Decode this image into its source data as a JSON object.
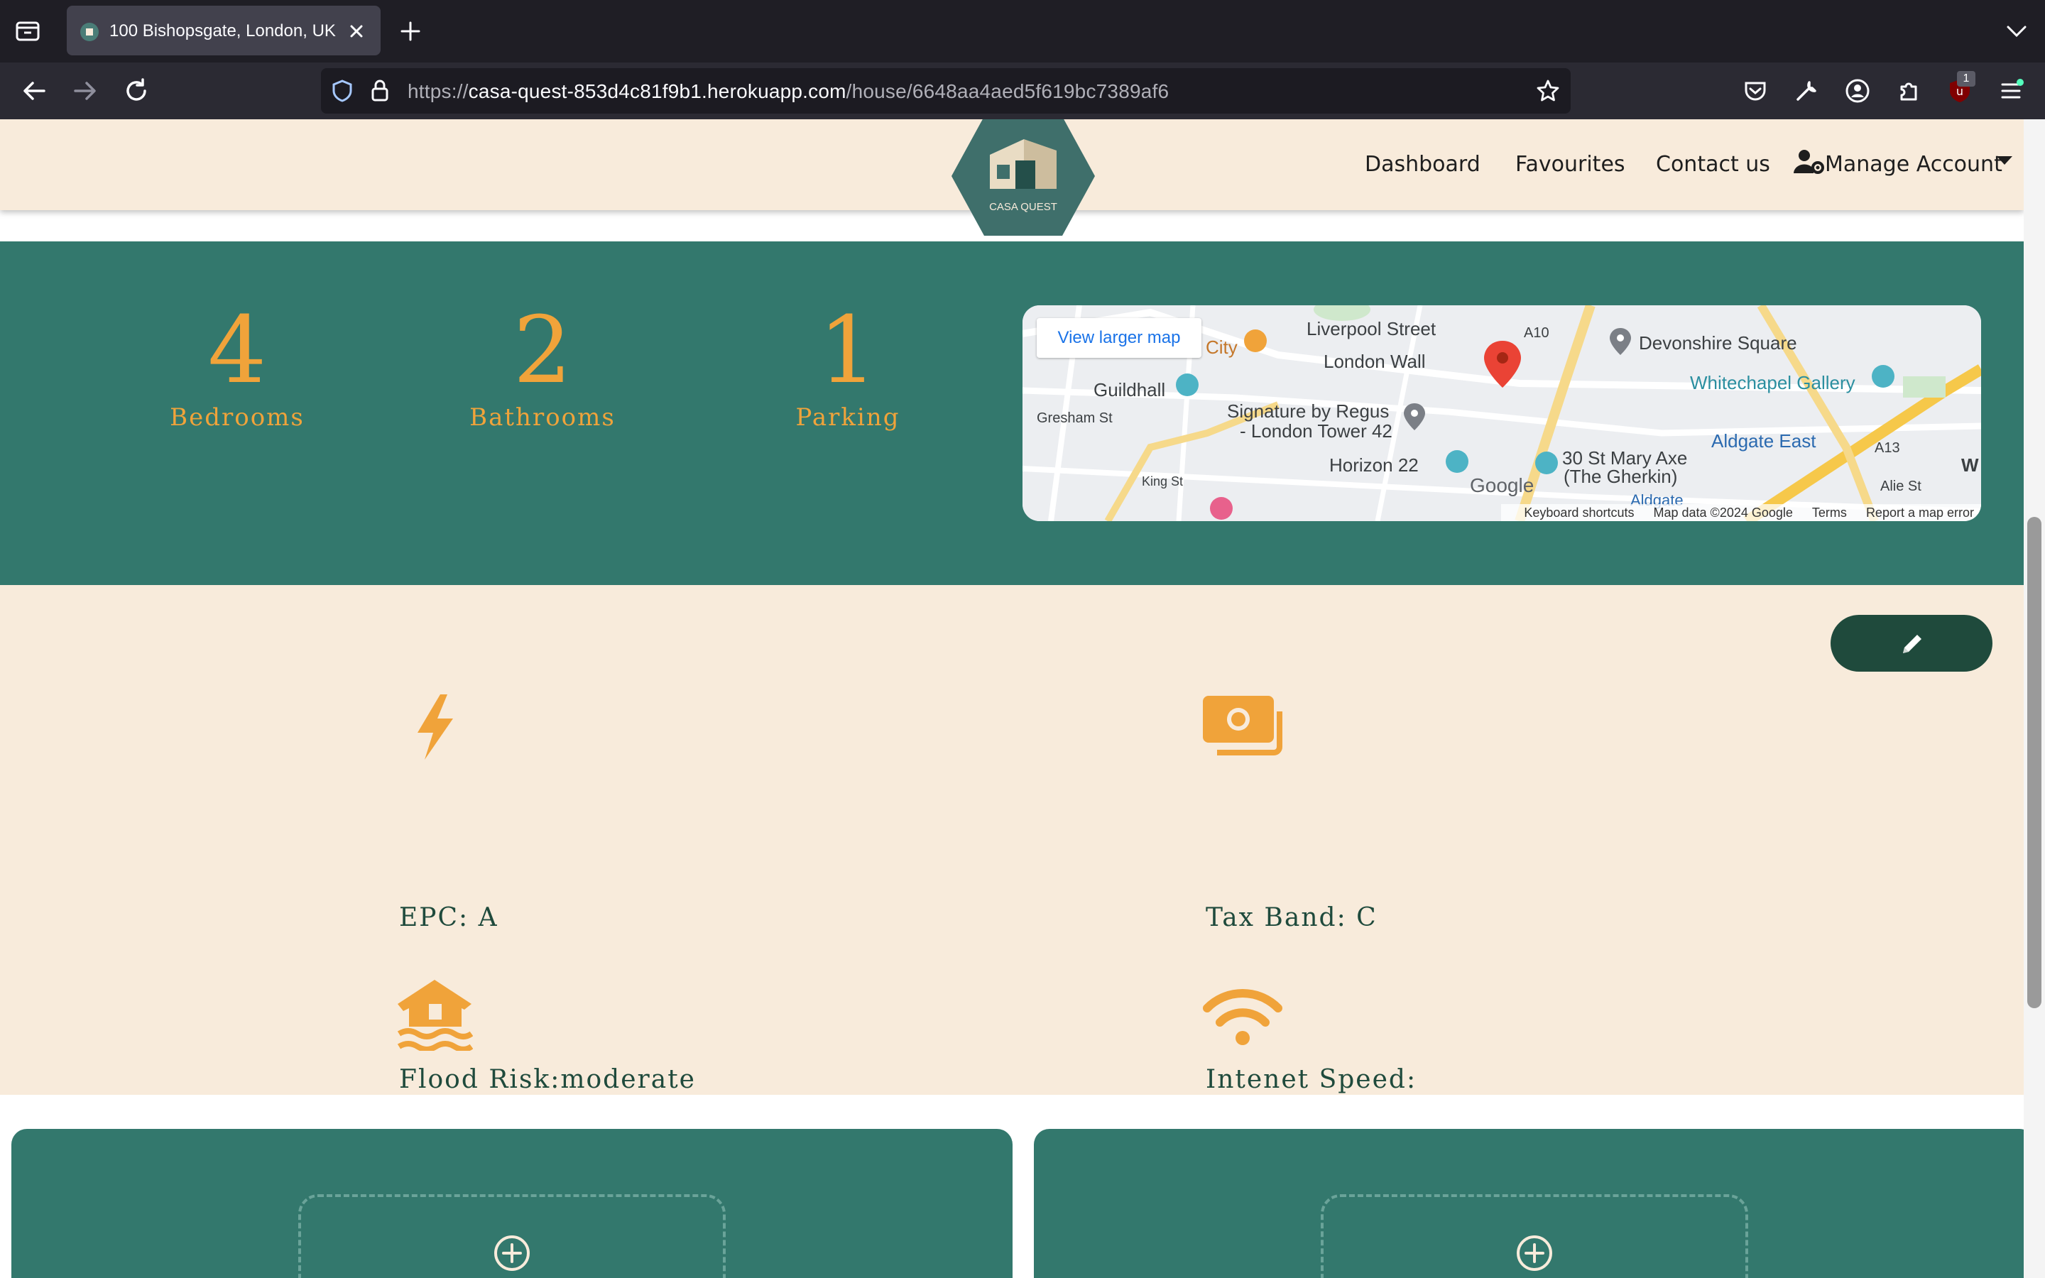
{
  "browser": {
    "tab_title": "100 Bishopsgate, London, UK",
    "url_scheme": "https://",
    "url_host": "casa-quest-853d4c81f9b1.herokuapp.com",
    "url_path": "/house/6648aa4aed5f619bc7389af6",
    "extension_badge": "1"
  },
  "header": {
    "logo_text": "CASA QUEST",
    "nav": [
      "Dashboard",
      "Favourites",
      "Contact us",
      "Manage Account"
    ]
  },
  "stats": [
    {
      "value": "4",
      "label": "Bedrooms"
    },
    {
      "value": "2",
      "label": "Bathrooms"
    },
    {
      "value": "1",
      "label": "Parking"
    }
  ],
  "map": {
    "view_larger": "View larger map",
    "labels": {
      "liverpool": "Liverpool Street",
      "devonshire": "Devonshire Square",
      "city": "City",
      "london_wall": "London Wall",
      "guildhall": "Guildhall",
      "whitechapel": "Whitechapel Gallery",
      "signature1": "Signature by Regus",
      "signature2": "- London Tower 42",
      "gresham": "Gresham St",
      "aldgate_east": "Aldgate East",
      "a10": "A10",
      "a13": "A13",
      "horizon": "Horizon 22",
      "mary_axe1": "30 St Mary Axe",
      "mary_axe2": "(The Gherkin)",
      "king_st": "King St",
      "alie_st": "Alie St",
      "aldgate": "Aldgate",
      "w": "W",
      "google": "Google"
    },
    "footer": {
      "shortcuts": "Keyboard shortcuts",
      "data": "Map data ©2024 Google",
      "terms": "Terms",
      "report": "Report a map error"
    }
  },
  "features": {
    "epc": "EPC: A",
    "tax": "Tax Band: C",
    "flood": "Flood Risk:moderate",
    "internet": "Intenet Speed:"
  },
  "colors": {
    "teal": "#33786d",
    "cream": "#f8ebdb",
    "orange": "#f0a33a",
    "dark_green": "#1f4a3c"
  }
}
